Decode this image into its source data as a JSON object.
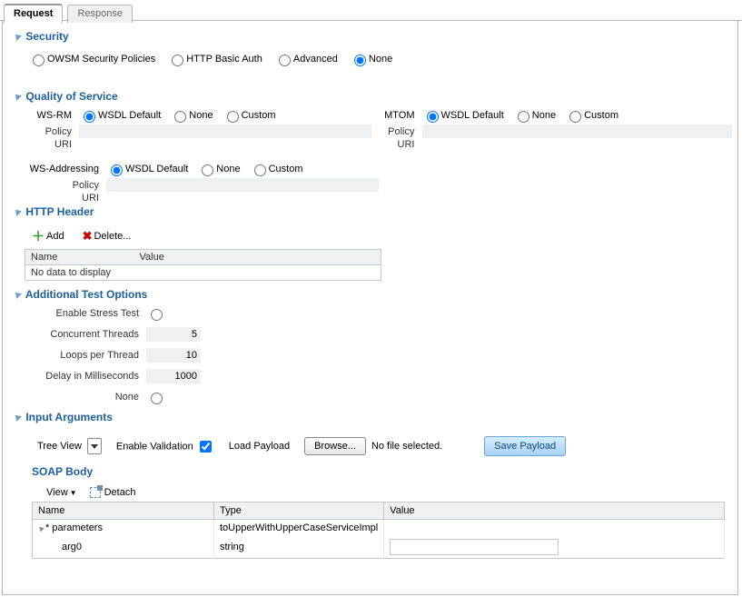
{
  "tabs": {
    "request": "Request",
    "response": "Response",
    "active": "request"
  },
  "security": {
    "title": "Security",
    "options": {
      "owsm": "OWSM Security Policies",
      "http": "HTTP Basic Auth",
      "advanced": "Advanced",
      "none": "None"
    },
    "selected": "none"
  },
  "qos": {
    "title": "Quality of Service",
    "wsrm": {
      "name": "WS-RM",
      "options": {
        "default": "WSDL Default",
        "none": "None",
        "custom": "Custom"
      },
      "selected": "default",
      "policy_label": "Policy",
      "uri_label": "URI",
      "policy": "",
      "uri": ""
    },
    "mtom": {
      "name": "MTOM",
      "options": {
        "default": "WSDL Default",
        "none": "None",
        "custom": "Custom"
      },
      "selected": "default",
      "policy_label": "Policy",
      "uri_label": "URI",
      "policy": "",
      "uri": ""
    },
    "wsa": {
      "name": "WS-Addressing",
      "options": {
        "default": "WSDL Default",
        "none": "None",
        "custom": "Custom"
      },
      "selected": "default",
      "policy_label": "Policy",
      "uri_label": "URI",
      "policy": "",
      "uri": ""
    }
  },
  "httpheader": {
    "title": "HTTP Header",
    "add": "Add",
    "delete": "Delete...",
    "col_name": "Name",
    "col_value": "Value",
    "empty": "No data to display"
  },
  "addopts": {
    "title": "Additional Test Options",
    "stress_label": "Enable Stress Test",
    "threads_label": "Concurrent Threads",
    "threads": "5",
    "loops_label": "Loops per Thread",
    "loops": "10",
    "delay_label": "Delay in Milliseconds",
    "delay": "1000",
    "none_label": "None"
  },
  "inputargs": {
    "title": "Input Arguments",
    "tree_view": "Tree View",
    "enable_validation": "Enable Validation",
    "load_payload": "Load Payload",
    "browse": "Browse...",
    "no_file": "No file selected.",
    "save_payload": "Save Payload"
  },
  "soap": {
    "title": "SOAP Body",
    "view": "View",
    "detach": "Detach",
    "col_name": "Name",
    "col_type": "Type",
    "col_value": "Value",
    "row1_name": "* parameters",
    "row1_type": "toUpperWithUpperCaseServiceImpl",
    "row2_name": "arg0",
    "row2_type": "string",
    "row2_value": ""
  }
}
